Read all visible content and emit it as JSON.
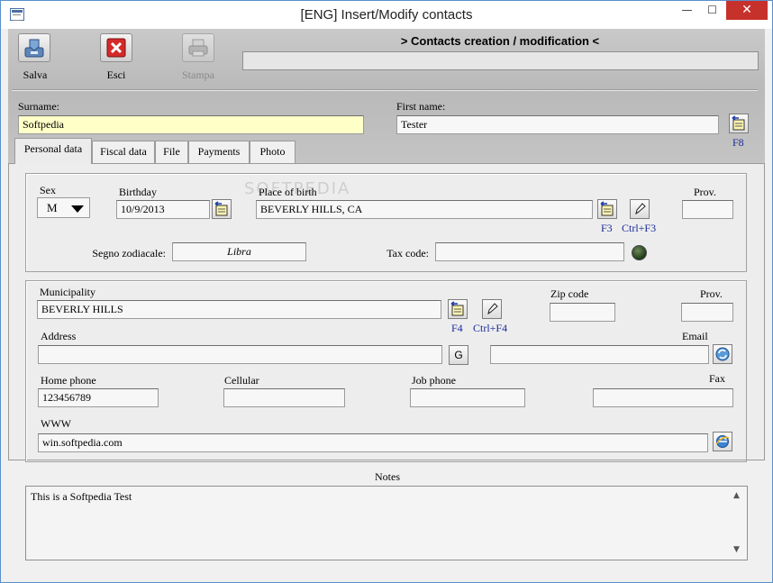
{
  "window": {
    "title": "[ENG] Insert/Modify contacts",
    "min_glyph": "—",
    "max_glyph": "☐",
    "close_glyph": "✕"
  },
  "toolbar": {
    "save_label": "Salva",
    "exit_label": "Esci",
    "print_label": "Stampa",
    "heading": "> Contacts creation / modification <",
    "heading_field_value": ""
  },
  "header": {
    "surname_label": "Surname:",
    "surname_value": "Softpedia",
    "firstname_label": "First name:",
    "firstname_value": "Tester",
    "lookup_key": "F8"
  },
  "tabs": [
    {
      "label": "Personal data",
      "active": true
    },
    {
      "label": "Fiscal data",
      "active": false
    },
    {
      "label": "File",
      "active": false
    },
    {
      "label": "Payments",
      "active": false
    },
    {
      "label": "Photo",
      "active": false
    }
  ],
  "personal": {
    "sex_label": "Sex",
    "sex_value": "M",
    "birthday_label": "Birthday",
    "birthday_value": "10/9/2013",
    "place_label": "Place of birth",
    "place_value": "BEVERLY HILLS, CA",
    "prov_label": "Prov.",
    "prov_value": "",
    "key_f3": "F3",
    "key_ctrl_f3": "Ctrl+F3",
    "zodiac_label": "Segno zodiacale:",
    "zodiac_value": "Libra",
    "taxcode_label": "Tax code:",
    "taxcode_value": ""
  },
  "address": {
    "municipality_label": "Municipality",
    "municipality_value": "BEVERLY HILLS",
    "key_f4": "F4",
    "key_ctrl_f4": "Ctrl+F4",
    "zip_label": "Zip code",
    "zip_value": "",
    "prov_label": "Prov.",
    "prov_value": "",
    "address_label": "Address",
    "address_value": "",
    "g_button": "G",
    "email_label": "Email",
    "email_value": "",
    "home_phone_label": "Home phone",
    "home_phone_value": "123456789",
    "cellular_label": "Cellular",
    "cellular_value": "",
    "job_phone_label": "Job phone",
    "job_phone_value": "",
    "fax_label": "Fax",
    "fax_value": "",
    "www_label": "WWW",
    "www_value": "win.softpedia.com"
  },
  "notes": {
    "label": "Notes",
    "value": "This is a Softpedia Test"
  },
  "watermark": "SOFTPEDIA",
  "colors": {
    "accent_yellow": "#ffffc8",
    "close_red": "#c7312b",
    "key_blue": "#1a2a9a"
  }
}
